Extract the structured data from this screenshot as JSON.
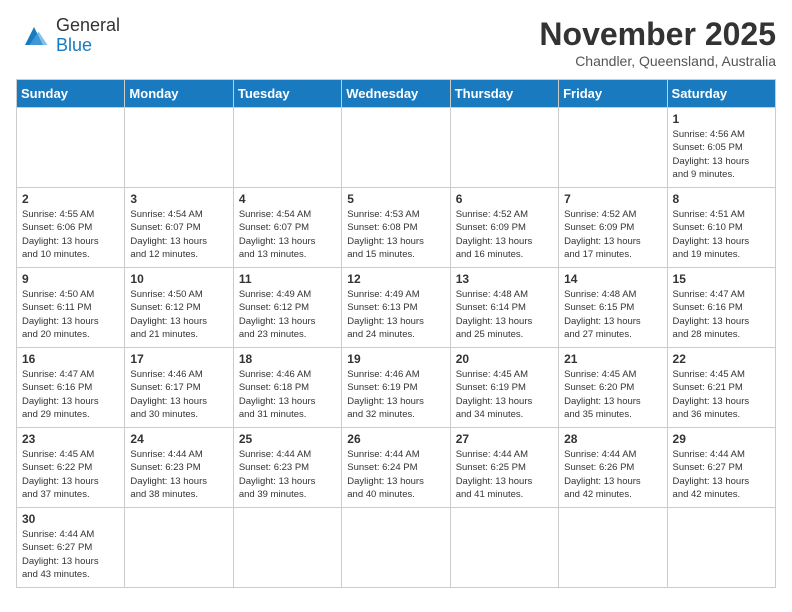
{
  "header": {
    "logo_line1": "General",
    "logo_line2": "Blue",
    "month": "November 2025",
    "location": "Chandler, Queensland, Australia"
  },
  "days_of_week": [
    "Sunday",
    "Monday",
    "Tuesday",
    "Wednesday",
    "Thursday",
    "Friday",
    "Saturday"
  ],
  "weeks": [
    [
      {
        "day": "",
        "info": ""
      },
      {
        "day": "",
        "info": ""
      },
      {
        "day": "",
        "info": ""
      },
      {
        "day": "",
        "info": ""
      },
      {
        "day": "",
        "info": ""
      },
      {
        "day": "",
        "info": ""
      },
      {
        "day": "1",
        "info": "Sunrise: 4:56 AM\nSunset: 6:05 PM\nDaylight: 13 hours\nand 9 minutes."
      }
    ],
    [
      {
        "day": "2",
        "info": "Sunrise: 4:55 AM\nSunset: 6:06 PM\nDaylight: 13 hours\nand 10 minutes."
      },
      {
        "day": "3",
        "info": "Sunrise: 4:54 AM\nSunset: 6:07 PM\nDaylight: 13 hours\nand 12 minutes."
      },
      {
        "day": "4",
        "info": "Sunrise: 4:54 AM\nSunset: 6:07 PM\nDaylight: 13 hours\nand 13 minutes."
      },
      {
        "day": "5",
        "info": "Sunrise: 4:53 AM\nSunset: 6:08 PM\nDaylight: 13 hours\nand 15 minutes."
      },
      {
        "day": "6",
        "info": "Sunrise: 4:52 AM\nSunset: 6:09 PM\nDaylight: 13 hours\nand 16 minutes."
      },
      {
        "day": "7",
        "info": "Sunrise: 4:52 AM\nSunset: 6:09 PM\nDaylight: 13 hours\nand 17 minutes."
      },
      {
        "day": "8",
        "info": "Sunrise: 4:51 AM\nSunset: 6:10 PM\nDaylight: 13 hours\nand 19 minutes."
      }
    ],
    [
      {
        "day": "9",
        "info": "Sunrise: 4:50 AM\nSunset: 6:11 PM\nDaylight: 13 hours\nand 20 minutes."
      },
      {
        "day": "10",
        "info": "Sunrise: 4:50 AM\nSunset: 6:12 PM\nDaylight: 13 hours\nand 21 minutes."
      },
      {
        "day": "11",
        "info": "Sunrise: 4:49 AM\nSunset: 6:12 PM\nDaylight: 13 hours\nand 23 minutes."
      },
      {
        "day": "12",
        "info": "Sunrise: 4:49 AM\nSunset: 6:13 PM\nDaylight: 13 hours\nand 24 minutes."
      },
      {
        "day": "13",
        "info": "Sunrise: 4:48 AM\nSunset: 6:14 PM\nDaylight: 13 hours\nand 25 minutes."
      },
      {
        "day": "14",
        "info": "Sunrise: 4:48 AM\nSunset: 6:15 PM\nDaylight: 13 hours\nand 27 minutes."
      },
      {
        "day": "15",
        "info": "Sunrise: 4:47 AM\nSunset: 6:16 PM\nDaylight: 13 hours\nand 28 minutes."
      }
    ],
    [
      {
        "day": "16",
        "info": "Sunrise: 4:47 AM\nSunset: 6:16 PM\nDaylight: 13 hours\nand 29 minutes."
      },
      {
        "day": "17",
        "info": "Sunrise: 4:46 AM\nSunset: 6:17 PM\nDaylight: 13 hours\nand 30 minutes."
      },
      {
        "day": "18",
        "info": "Sunrise: 4:46 AM\nSunset: 6:18 PM\nDaylight: 13 hours\nand 31 minutes."
      },
      {
        "day": "19",
        "info": "Sunrise: 4:46 AM\nSunset: 6:19 PM\nDaylight: 13 hours\nand 32 minutes."
      },
      {
        "day": "20",
        "info": "Sunrise: 4:45 AM\nSunset: 6:19 PM\nDaylight: 13 hours\nand 34 minutes."
      },
      {
        "day": "21",
        "info": "Sunrise: 4:45 AM\nSunset: 6:20 PM\nDaylight: 13 hours\nand 35 minutes."
      },
      {
        "day": "22",
        "info": "Sunrise: 4:45 AM\nSunset: 6:21 PM\nDaylight: 13 hours\nand 36 minutes."
      }
    ],
    [
      {
        "day": "23",
        "info": "Sunrise: 4:45 AM\nSunset: 6:22 PM\nDaylight: 13 hours\nand 37 minutes."
      },
      {
        "day": "24",
        "info": "Sunrise: 4:44 AM\nSunset: 6:23 PM\nDaylight: 13 hours\nand 38 minutes."
      },
      {
        "day": "25",
        "info": "Sunrise: 4:44 AM\nSunset: 6:23 PM\nDaylight: 13 hours\nand 39 minutes."
      },
      {
        "day": "26",
        "info": "Sunrise: 4:44 AM\nSunset: 6:24 PM\nDaylight: 13 hours\nand 40 minutes."
      },
      {
        "day": "27",
        "info": "Sunrise: 4:44 AM\nSunset: 6:25 PM\nDaylight: 13 hours\nand 41 minutes."
      },
      {
        "day": "28",
        "info": "Sunrise: 4:44 AM\nSunset: 6:26 PM\nDaylight: 13 hours\nand 42 minutes."
      },
      {
        "day": "29",
        "info": "Sunrise: 4:44 AM\nSunset: 6:27 PM\nDaylight: 13 hours\nand 42 minutes."
      }
    ],
    [
      {
        "day": "30",
        "info": "Sunrise: 4:44 AM\nSunset: 6:27 PM\nDaylight: 13 hours\nand 43 minutes."
      },
      {
        "day": "",
        "info": ""
      },
      {
        "day": "",
        "info": ""
      },
      {
        "day": "",
        "info": ""
      },
      {
        "day": "",
        "info": ""
      },
      {
        "day": "",
        "info": ""
      },
      {
        "day": "",
        "info": ""
      }
    ]
  ]
}
